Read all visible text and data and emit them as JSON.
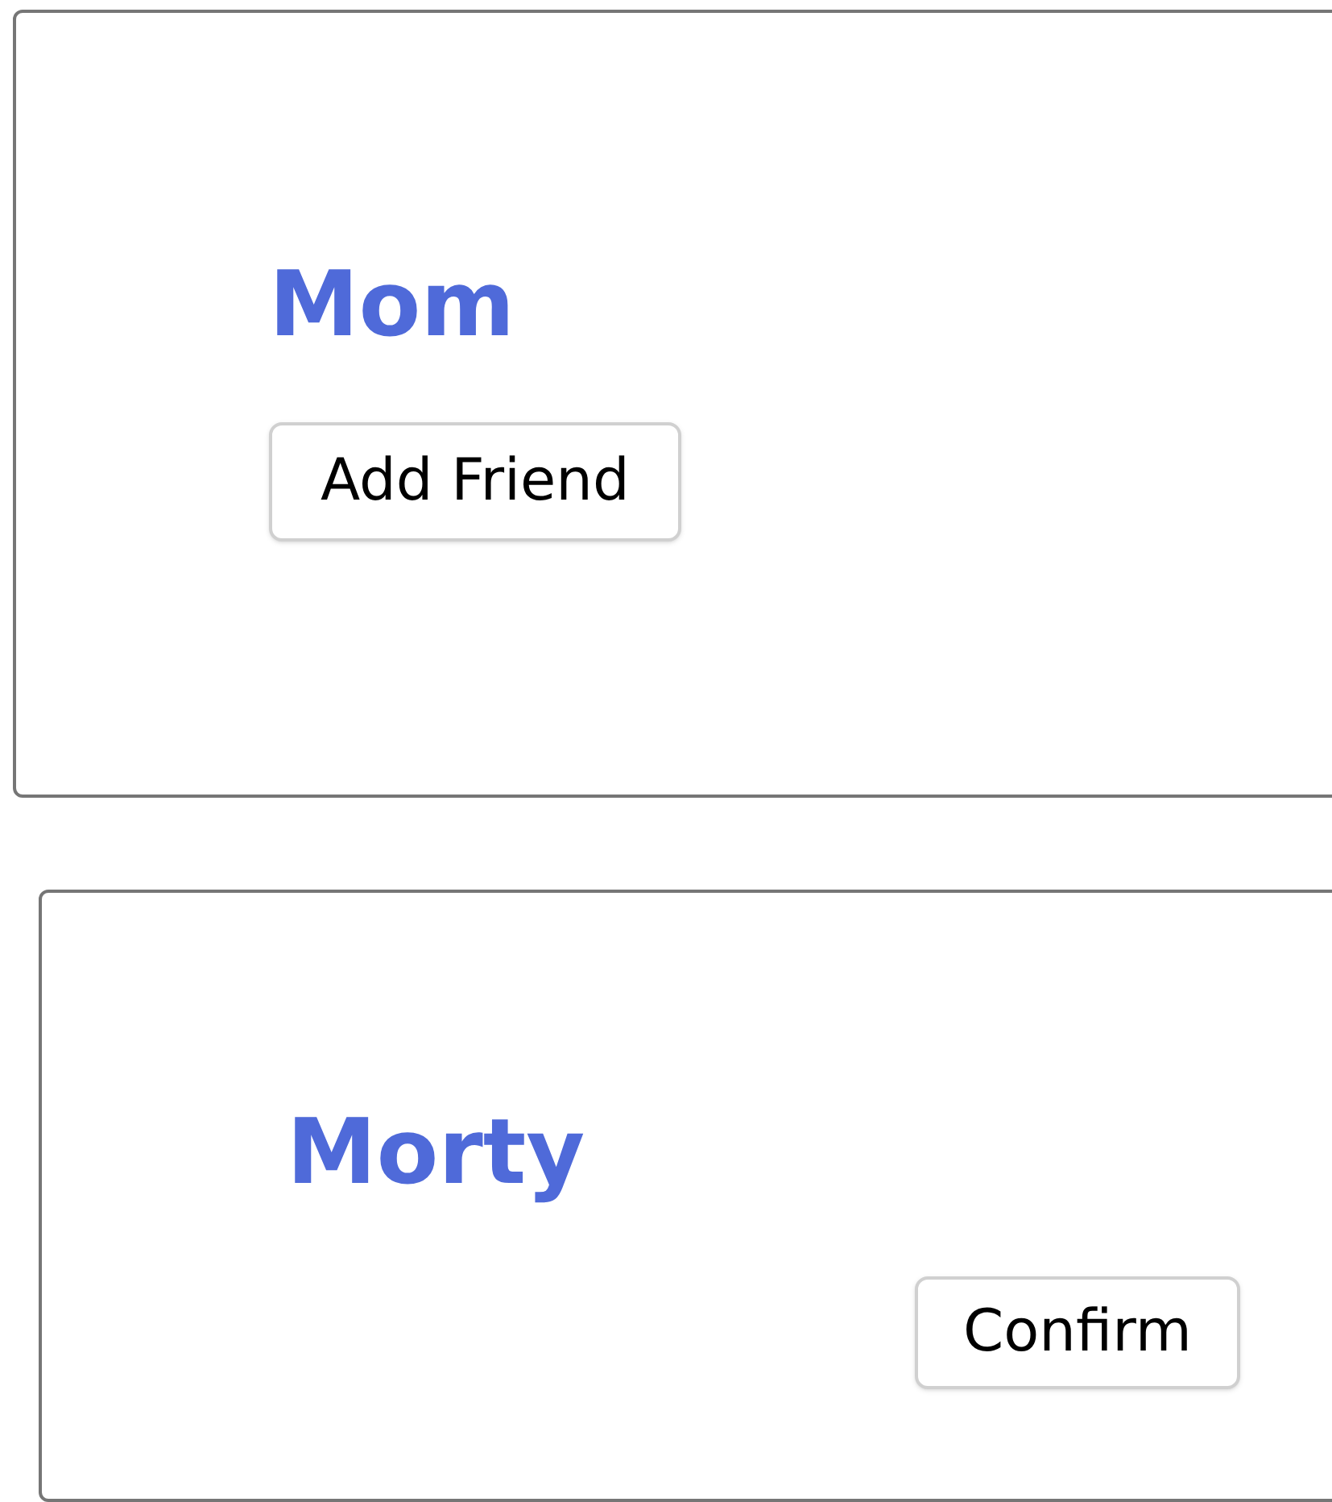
{
  "cards": [
    {
      "name": "Mom",
      "button": "Add Friend"
    },
    {
      "name": "Morty",
      "button": "Confirm"
    }
  ]
}
